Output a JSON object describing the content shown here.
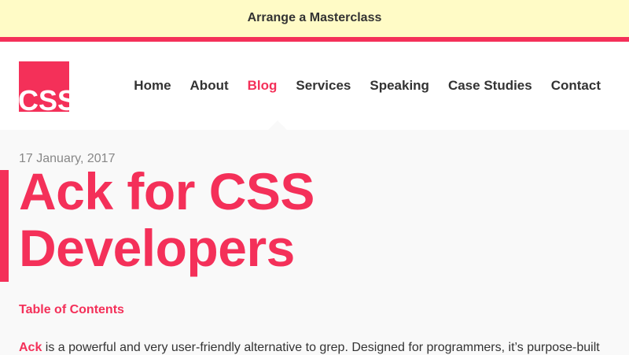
{
  "promo": {
    "label": "Arrange a Masterclass"
  },
  "logo": {
    "text": "CSS"
  },
  "nav": {
    "items": [
      {
        "label": "Home"
      },
      {
        "label": "About"
      },
      {
        "label": "Blog"
      },
      {
        "label": "Services"
      },
      {
        "label": "Speaking"
      },
      {
        "label": "Case Studies"
      },
      {
        "label": "Contact"
      }
    ],
    "active": "Blog"
  },
  "post": {
    "date": "17 January, 2017",
    "title": "Ack for CSS Developers",
    "toc_label": "Table of Contents",
    "intro_link": "Ack",
    "intro_text": " is a powerful and very user-friendly alternative to grep. Designed for programmers, it’s purpose-built"
  },
  "colors": {
    "accent": "#f43059",
    "promo_bg": "#fffbc6",
    "text": "#333333",
    "muted": "#888888"
  }
}
